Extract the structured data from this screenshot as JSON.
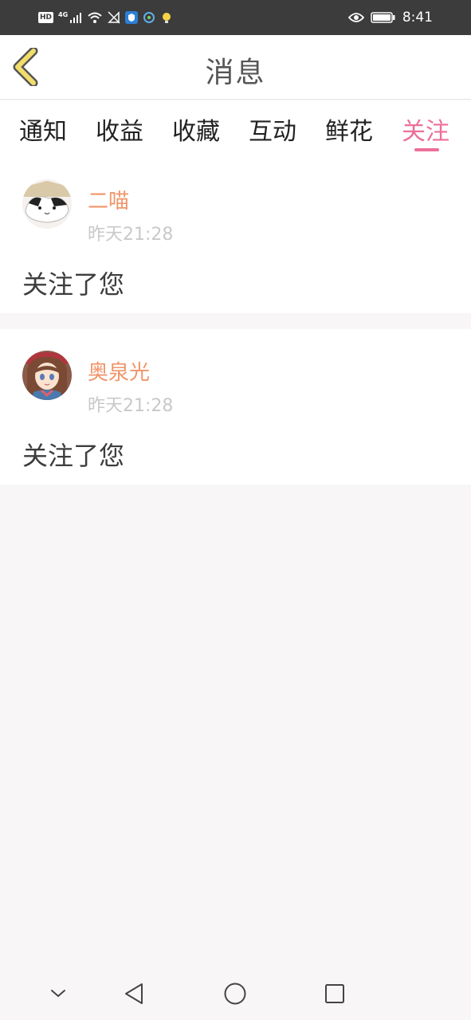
{
  "status_bar": {
    "network_badge": "HD",
    "network_type": "4G",
    "time": "8:41"
  },
  "header": {
    "title": "消息",
    "back_icon": "chevron-left-icon"
  },
  "tabs": [
    {
      "label": "通知",
      "active": false
    },
    {
      "label": "收益",
      "active": false
    },
    {
      "label": "收藏",
      "active": false
    },
    {
      "label": "互动",
      "active": false
    },
    {
      "label": "鲜花",
      "active": false
    },
    {
      "label": "关注",
      "active": true
    }
  ],
  "messages": [
    {
      "username": "二喵",
      "time": "昨天21:28",
      "text": "关注了您"
    },
    {
      "username": "奥泉光",
      "time": "昨天21:28",
      "text": "关注了您"
    }
  ],
  "colors": {
    "accent": "#ec6f9a",
    "username": "#f0956a",
    "back_icon": "#f3dd6a"
  }
}
